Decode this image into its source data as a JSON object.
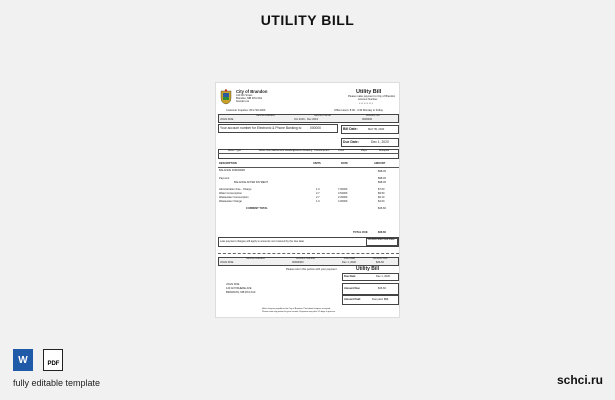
{
  "page_title": "UTILITY BILL",
  "footer": {
    "caption": "fully editable template",
    "site": "schci.ru",
    "word_icon_label": "W",
    "pdf_icon_label": "PDF"
  },
  "bill": {
    "org_name": "City of Brandon",
    "org_addr1": "410 9th Street",
    "org_addr2": "Brandon, MB R7A 6A2",
    "org_web": "brandon.ca",
    "heading": "Utility Bill",
    "heading_sub1": "Please make payment to City of Brandon",
    "heading_sub2": "Account Number",
    "heading_sub3": "• • • • • • • • •",
    "contact_line": "Customer Inquiries: 204-729-2000",
    "office_hours": "Office Hours: 8:00 - 4:30 Monday to Friday",
    "col_service_addr": "Service Address",
    "col_service_period": "Service Period",
    "col_account_no": "Account No.",
    "service_addr": "JOHN DOE",
    "service_period": "Oct 2019 - Nov 2019",
    "account_no": "0000000",
    "notice": "Your account number for Electronic & Phone Banking is:",
    "notice_value": "000000",
    "bill_date_label": "Bill Date:",
    "bill_date_value": "MAY 05, 2020",
    "due_date_label": "Due Date:",
    "due_date_value": "Dec 1, 2020",
    "meter_headers": [
      "Meter Type",
      "Meter Number",
      "Previous Reading",
      "Present Reading",
      "Consumption",
      "Units",
      "Days",
      "Multiplier"
    ],
    "desc_header": "DESCRIPTION",
    "units_header": "UNITS",
    "rate_header": "RATE",
    "amount_header": "AMOUNT",
    "previous_balance_label": "BALANCE FORWARD",
    "previous_balance": "$98.45",
    "payment_label": "Payment",
    "payment_value": "$98.45",
    "balance_forward_label": "BALANCE AFTER PAYMENT",
    "balance_forward_value": "$98.45",
    "charges": [
      {
        "desc": "Administration Fee - Charge",
        "units": "1.0",
        "rate": "7.00000",
        "amount": "$7.00"
      },
      {
        "desc": "Water Consumption",
        "units": "2.7",
        "rate": "3.52000",
        "amount": "$9.50"
      },
      {
        "desc": "Wastewater Consumption",
        "units": "2.7",
        "rate": "2.26000",
        "amount": "$6.10"
      },
      {
        "desc": "Wastewater Charge",
        "units": "1.0",
        "rate": "4.00000",
        "amount": "$4.00"
      }
    ],
    "current_total_label": "CURRENT TOTAL",
    "current_total_value": "$26.60",
    "total_label": "TOTAL DUE",
    "total_value": "$26.60",
    "late_note": "Late payment charges will apply to amounts not received by the due date",
    "late_box": "Amount after Due Date",
    "stub_headers": [
      "Service Address",
      "Account Number",
      "Due Date",
      "Amount Due"
    ],
    "stub_values": [
      "JOHN DOE",
      "00000000",
      "Dec 1, 2020",
      "$26.60"
    ],
    "stub_heading": "Utility Bill",
    "stub_sub": "Please return this portion with your payment",
    "stub_due_label": "Due Date:",
    "stub_due_value": "Dec 1, 2020",
    "stub_amount_due_label": "Amount Due:",
    "stub_amount_due_value": "$26.60",
    "stub_amount_paid_label": "Amount Paid:",
    "stub_amount_paid_value": "Due paid: $$$",
    "customer_name": "JOHN DOE",
    "customer_addr1": "123 ANYWHERE AVE",
    "customer_addr2": "BRANDON, MB  R7A 0A0",
    "bottom_note1": "Make cheques payable to the City of Brandon. Post-dated cheques accepted.",
    "bottom_note2": "Please retain top portion for your records. Payments may take 3-5 days to process."
  }
}
